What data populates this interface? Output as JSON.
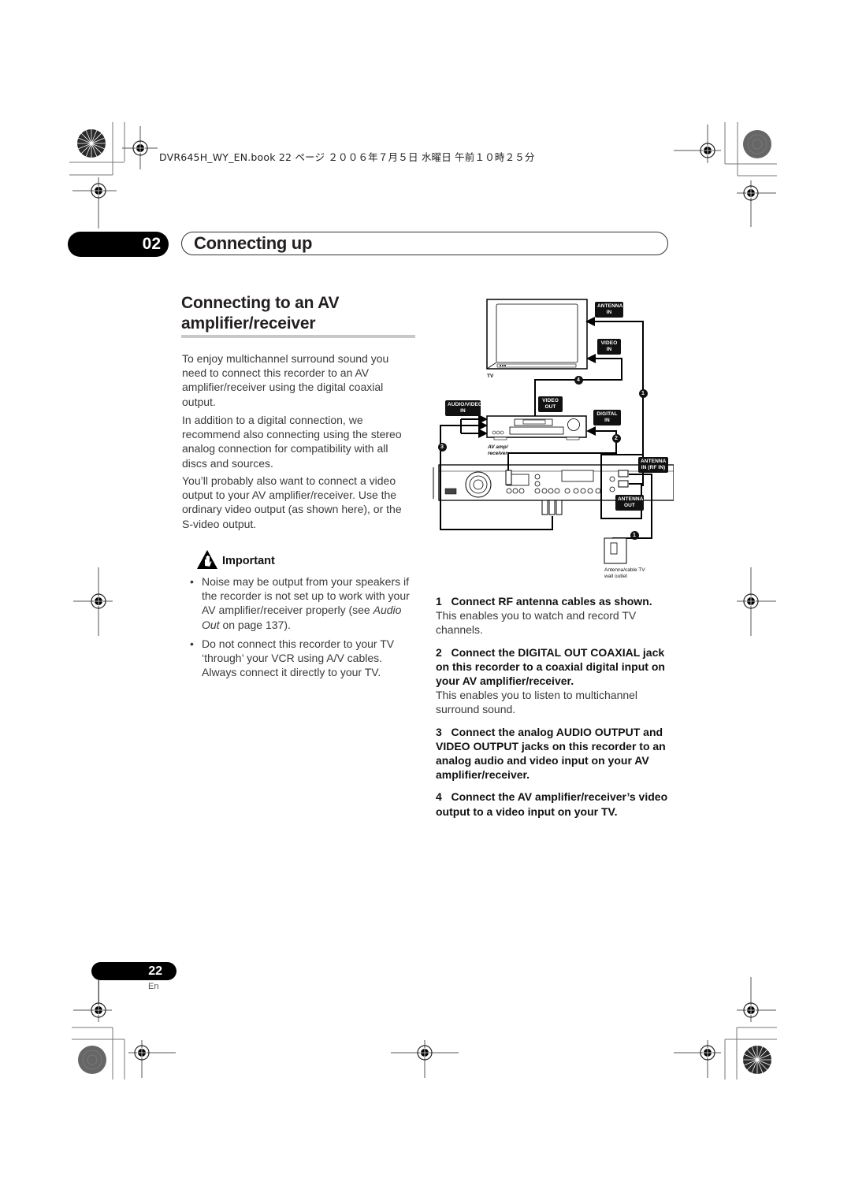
{
  "header": {
    "file_line": "DVR645H_WY_EN.book  22 ページ  ２００６年７月５日  水曜日  午前１０時２５分"
  },
  "chapter": {
    "number": "02",
    "title": "Connecting up"
  },
  "section": {
    "title_line1": "Connecting to an AV",
    "title_line2": "amplifier/receiver"
  },
  "intro_paragraphs": [
    "To enjoy multichannel surround sound you need to connect this recorder to an AV amplifier/receiver using the digital coaxial output.",
    "In addition to a digital connection, we recommend also connecting using the stereo analog connection for compatibility with all discs and sources.",
    "You’ll probably also want to connect a video output to your AV amplifier/receiver. Use the ordinary video output (as shown here), or the S-video output."
  ],
  "important": {
    "icon": "important-hand-warning-icon",
    "label": "Important",
    "bullets": [
      {
        "before": "Noise may be output from your speakers if the recorder is not set up to work with your AV amplifier/receiver properly (see ",
        "italic": "Audio Out",
        "after": " on page 137)."
      },
      {
        "before": "Do not connect this recorder to your TV ‘through’ your VCR using A/V cables. Always connect it directly to your TV.",
        "italic": "",
        "after": ""
      }
    ]
  },
  "diagram": {
    "labels": {
      "tv": "TV",
      "antenna_in": [
        "ANTENNA",
        "IN"
      ],
      "video_in": [
        "VIDEO",
        "IN"
      ],
      "audio_video_in": [
        "AUDIO/VIDEO",
        "IN"
      ],
      "video_out": [
        "VIDEO",
        "OUT"
      ],
      "digital_in": [
        "DIGITAL",
        "IN"
      ],
      "av_amp": [
        "AV amp/",
        "receiver"
      ],
      "antenna_in_rf": [
        "ANTENNA",
        "IN (RF IN)"
      ],
      "antenna_out": [
        "ANTENNA",
        "OUT"
      ],
      "wall_outlet": [
        "Antenna/cable TV",
        "wall outlet"
      ]
    },
    "callouts": [
      "1",
      "2",
      "3",
      "4",
      "1"
    ]
  },
  "steps": [
    {
      "number": "1",
      "heading": "Connect RF antenna cables as shown.",
      "body": "This enables you to watch and record TV channels."
    },
    {
      "number": "2",
      "heading": "Connect the DIGITAL OUT  COAXIAL jack on this recorder to a coaxial digital input on your AV amplifier/receiver.",
      "body": "This enables you to listen to multichannel surround sound."
    },
    {
      "number": "3",
      "heading": "Connect the analog AUDIO OUTPUT and VIDEO OUTPUT jacks on this recorder to an analog audio and video input on your AV amplifier/receiver.",
      "body": ""
    },
    {
      "number": "4",
      "heading": "Connect the AV amplifier/receiver’s video output to a video input on your TV.",
      "body": ""
    }
  ],
  "footer": {
    "page_number": "22",
    "language": "En"
  }
}
